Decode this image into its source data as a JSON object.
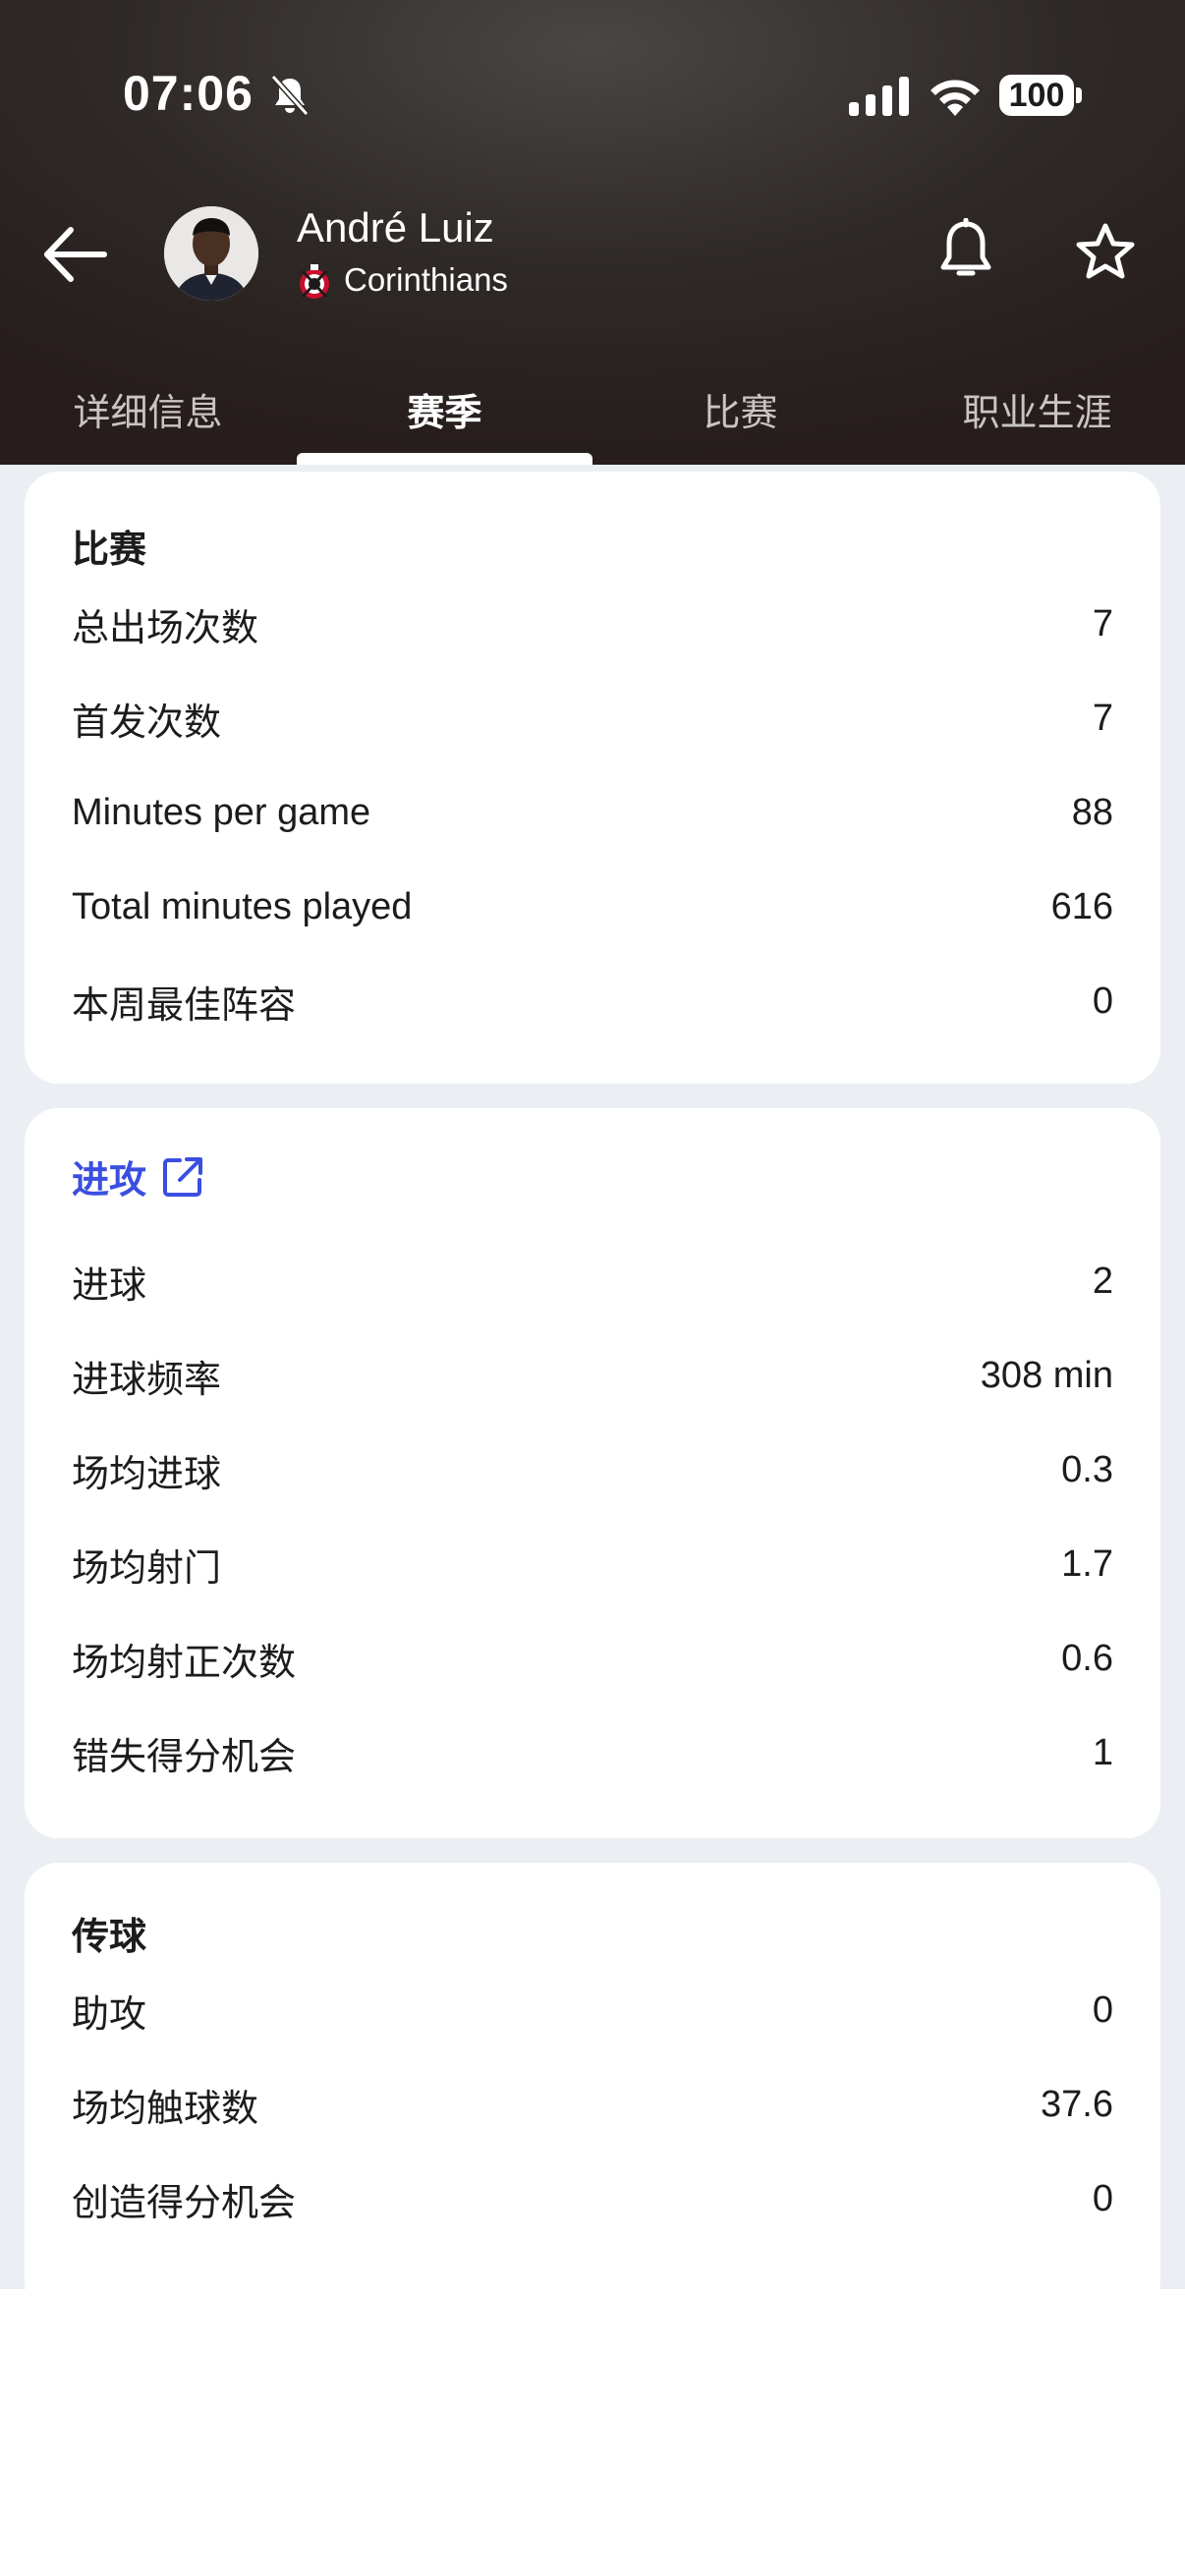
{
  "status_bar": {
    "time": "07:06",
    "battery": "100"
  },
  "player": {
    "name": "André Luiz",
    "club": "Corinthians"
  },
  "tabs": [
    {
      "label": "详细信息"
    },
    {
      "label": "赛季"
    },
    {
      "label": "比赛"
    },
    {
      "label": "职业生涯"
    }
  ],
  "active_tab": "赛季",
  "sections": {
    "matches": {
      "title": "比赛",
      "rows": [
        {
          "label": "总出场次数",
          "value": "7"
        },
        {
          "label": "首发次数",
          "value": "7"
        },
        {
          "label": "Minutes per game",
          "value": "88"
        },
        {
          "label": "Total minutes played",
          "value": "616"
        },
        {
          "label": "本周最佳阵容",
          "value": "0"
        }
      ]
    },
    "attack": {
      "title": "进攻",
      "rows": [
        {
          "label": "进球",
          "value": "2"
        },
        {
          "label": "进球频率",
          "value": "308 min"
        },
        {
          "label": "场均进球",
          "value": "0.3"
        },
        {
          "label": "场均射门",
          "value": "1.7"
        },
        {
          "label": "场均射正次数",
          "value": "0.6"
        },
        {
          "label": "错失得分机会",
          "value": "1"
        }
      ]
    },
    "passing": {
      "title": "传球",
      "rows": [
        {
          "label": "助攻",
          "value": "0"
        },
        {
          "label": "场均触球数",
          "value": "37.6"
        },
        {
          "label": "创造得分机会",
          "value": "0"
        }
      ]
    }
  },
  "colors": {
    "accent_link": "#3a4ee0",
    "header_bg": "#2e2927",
    "content_bg": "#ebeef2"
  }
}
